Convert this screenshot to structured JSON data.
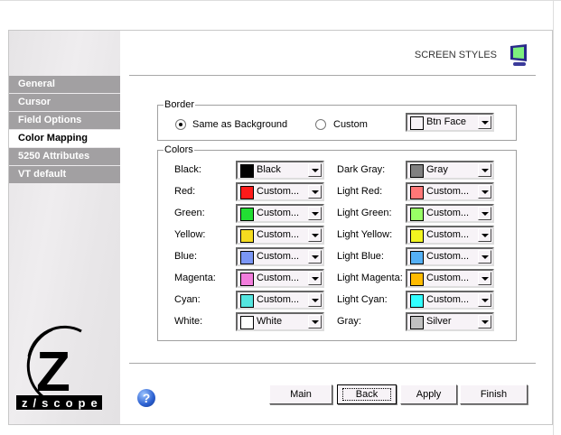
{
  "header": {
    "title": "SCREEN STYLES",
    "icon": "monitor-icon"
  },
  "sidebar": {
    "items": [
      {
        "label": "General",
        "active": false
      },
      {
        "label": "Cursor",
        "active": false
      },
      {
        "label": "Field Options",
        "active": false
      },
      {
        "label": "Color Mapping",
        "active": true
      },
      {
        "label": "5250 Attributes",
        "active": false
      },
      {
        "label": "VT default",
        "active": false
      }
    ]
  },
  "logo": {
    "text": "z scope",
    "letter": "Z"
  },
  "border": {
    "legend": "Border",
    "same_label": "Same as Background",
    "same_selected": true,
    "custom_label": "Custom",
    "custom_selected": false,
    "color": {
      "value": "Btn Face",
      "swatch": "#f7f3f7"
    }
  },
  "colors": {
    "legend": "Colors",
    "left": [
      {
        "label": "Black:",
        "value": "Black",
        "swatch": "#000000"
      },
      {
        "label": "Red:",
        "value": "Custom...",
        "swatch": "#ff1a1a"
      },
      {
        "label": "Green:",
        "value": "Custom...",
        "swatch": "#22dd33"
      },
      {
        "label": "Yellow:",
        "value": "Custom...",
        "swatch": "#f5dc20"
      },
      {
        "label": "Blue:",
        "value": "Custom...",
        "swatch": "#7b96f5"
      },
      {
        "label": "Magenta:",
        "value": "Custom...",
        "swatch": "#f27ddc"
      },
      {
        "label": "Cyan:",
        "value": "Custom...",
        "swatch": "#55e6e0"
      },
      {
        "label": "White:",
        "value": "White",
        "swatch": "#ffffff"
      }
    ],
    "right": [
      {
        "label": "Dark Gray:",
        "value": "Gray",
        "swatch": "#808080"
      },
      {
        "label": "Light Red:",
        "value": "Custom...",
        "swatch": "#ff7777"
      },
      {
        "label": "Light Green:",
        "value": "Custom...",
        "swatch": "#99ff66"
      },
      {
        "label": "Light Yellow:",
        "value": "Custom...",
        "swatch": "#f2f520"
      },
      {
        "label": "Light Blue:",
        "value": "Custom...",
        "swatch": "#55b0f5"
      },
      {
        "label": "Light Magenta:",
        "value": "Custom...",
        "swatch": "#ffbb00"
      },
      {
        "label": "Light Cyan:",
        "value": "Custom...",
        "swatch": "#33ffff"
      },
      {
        "label": "Gray:",
        "value": "Silver",
        "swatch": "#c0c0c0"
      }
    ]
  },
  "buttons": {
    "help": "?",
    "main": "Main",
    "back": "Back",
    "apply": "Apply",
    "finish": "Finish"
  }
}
